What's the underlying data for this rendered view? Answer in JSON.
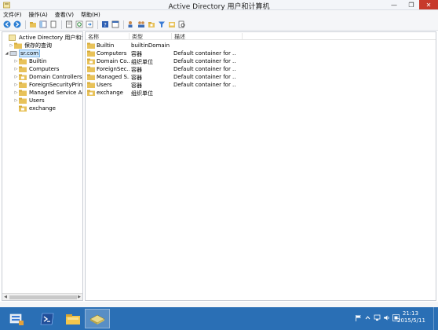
{
  "window": {
    "title": "Active Directory 用户和计算机",
    "controls": {
      "minimize": "—",
      "maximize": "❐",
      "close": "✕"
    }
  },
  "menu": [
    "文件(F)",
    "操作(A)",
    "查看(V)",
    "帮助(H)"
  ],
  "tree": {
    "root": "Active Directory 用户和计算机",
    "saved_queries": "保存的查询",
    "domain": "sr.com",
    "children": [
      "Builtin",
      "Computers",
      "Domain Controllers",
      "ForeignSecurityPrincipals",
      "Managed Service Accounts",
      "Users",
      "exchange"
    ]
  },
  "list": {
    "columns": [
      "名称",
      "类型",
      "描述"
    ],
    "rows": [
      {
        "name": "Builtin",
        "type": "builtinDomain",
        "desc": ""
      },
      {
        "name": "Computers",
        "type": "容器",
        "desc": "Default container for ..."
      },
      {
        "name": "Domain Co...",
        "type": "组织单位",
        "desc": "Default container for ..."
      },
      {
        "name": "ForeignSec...",
        "type": "容器",
        "desc": "Default container for ..."
      },
      {
        "name": "Managed S...",
        "type": "容器",
        "desc": "Default container for ..."
      },
      {
        "name": "Users",
        "type": "容器",
        "desc": "Default container for ..."
      },
      {
        "name": "exchange",
        "type": "组织单位",
        "desc": ""
      }
    ]
  },
  "taskbar": {
    "clock_time": "21:13",
    "clock_date": "2015/5/11"
  },
  "colors": {
    "taskbar": "#2a6fb5",
    "close_button": "#c7392b",
    "selection": "#cde8ff",
    "folder": "#e8c25a"
  }
}
